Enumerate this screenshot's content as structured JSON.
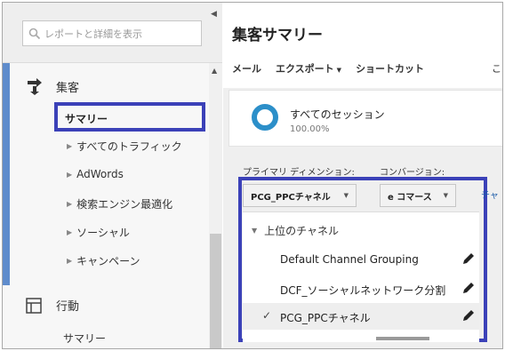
{
  "sidebar": {
    "search_placeholder": "レポートと詳細を表示",
    "sections": [
      {
        "label": "集客",
        "icon": "acquisition-icon"
      },
      {
        "label": "行動",
        "icon": "behavior-icon"
      }
    ],
    "acquisition_items": [
      {
        "label": "サマリー",
        "selected": true
      },
      {
        "label": "すべてのトラフィック"
      },
      {
        "label": "AdWords"
      },
      {
        "label": "検索エンジン最適化"
      },
      {
        "label": "ソーシャル"
      },
      {
        "label": "キャンペーン"
      }
    ],
    "behavior_items": [
      {
        "label": "サマリー"
      }
    ]
  },
  "main": {
    "title": "集客サマリー",
    "toolbar": {
      "email": "メール",
      "export": "エクスポート",
      "shortcut": "ショートカット",
      "cut_char": "こ"
    },
    "segment": {
      "name": "すべてのセッション",
      "percent": "100.00%"
    },
    "primary_dimension_label": "プライマリ ディメンション:",
    "conversion_label": "コンバージョン:",
    "dimension_value": "PCG_PPCチャネル",
    "conversion_value": "e コマース",
    "truncated_link": "チャ",
    "menu": {
      "group": "上位のチャネル",
      "items": [
        {
          "label": "Default Channel Grouping",
          "selected": false
        },
        {
          "label": "DCF_ソーシャルネットワーク分割",
          "selected": false
        },
        {
          "label": "PCG_PPCチャネル",
          "selected": true
        }
      ]
    }
  },
  "colors": {
    "highlight_frame": "#3b41b8",
    "active_bar": "#5f8ccc",
    "segment_ring": "#2c8fc9"
  }
}
